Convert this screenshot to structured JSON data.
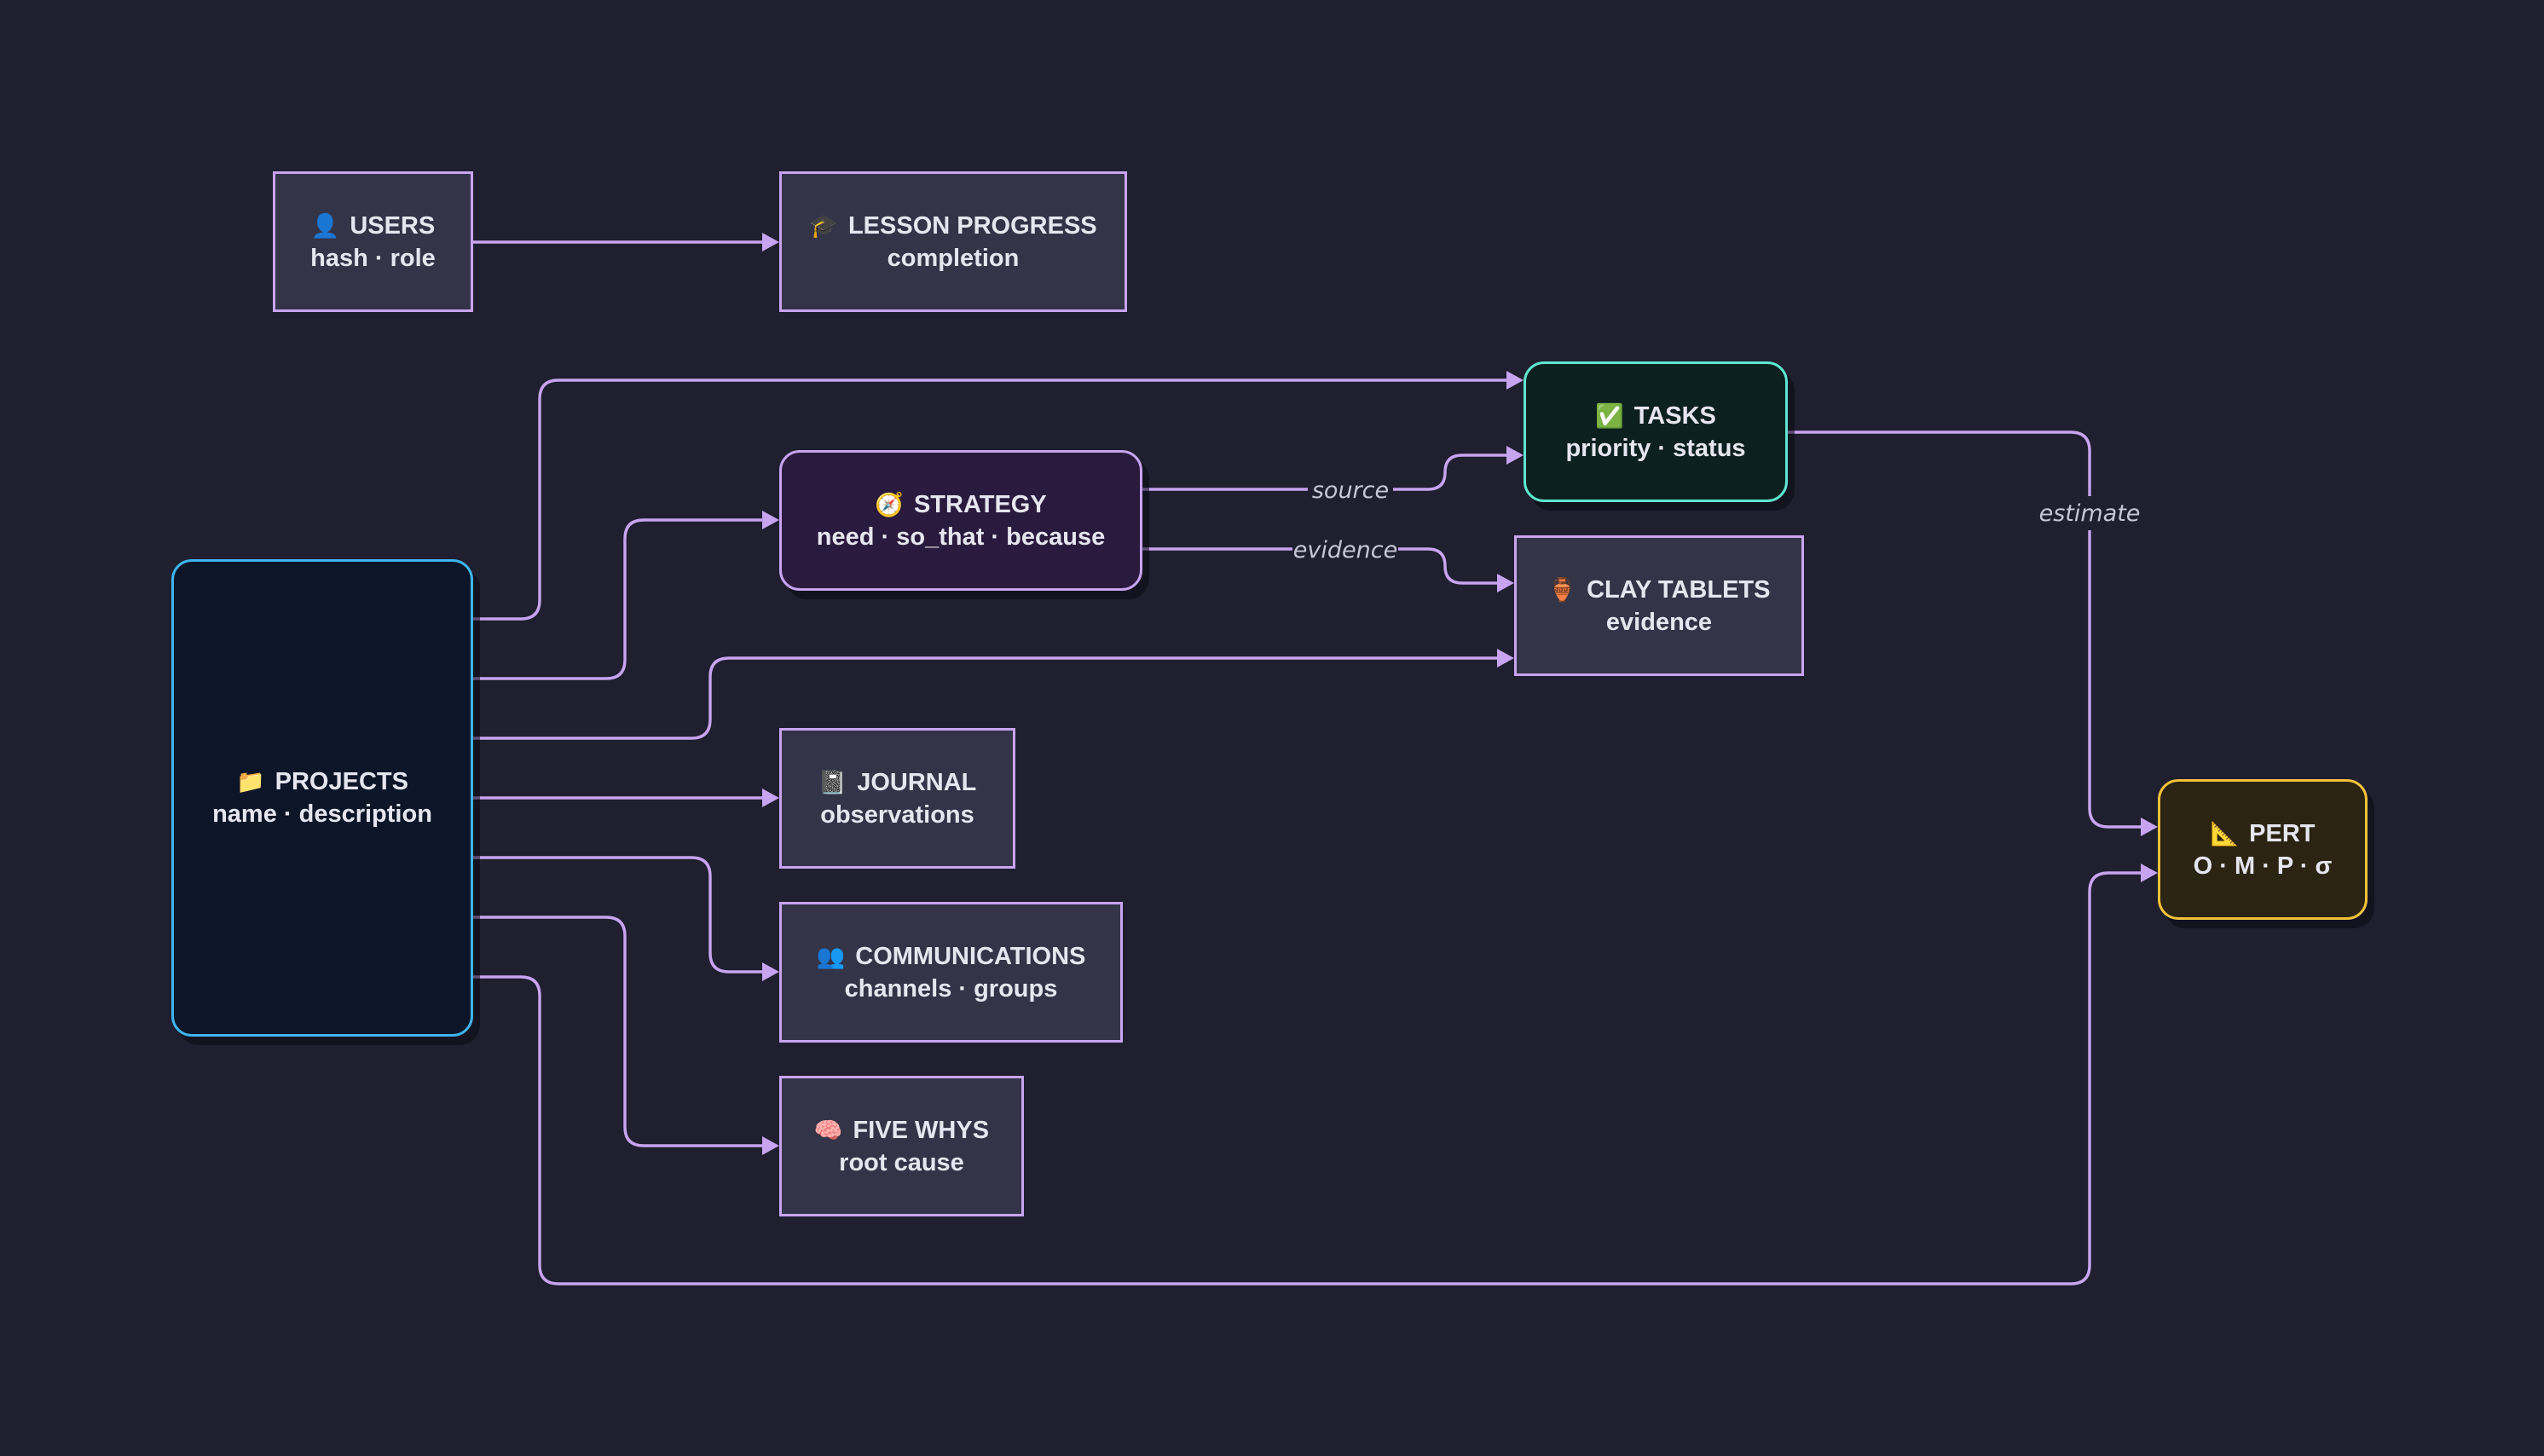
{
  "nodes": {
    "users": {
      "icon": "👤",
      "icon_name": "user-icon",
      "title": "USERS",
      "sub": "hash · role"
    },
    "lesson_progress": {
      "icon": "🎓",
      "icon_name": "graduation-cap-icon",
      "title": "LESSON PROGRESS",
      "sub": "completion"
    },
    "tasks": {
      "icon": "✅",
      "icon_name": "check-box-icon",
      "title": "TASKS",
      "sub": "priority · status"
    },
    "strategy": {
      "icon": "🧭",
      "icon_name": "compass-icon",
      "title": "STRATEGY",
      "sub": "need · so_that · because"
    },
    "clay_tablets": {
      "icon": "🏺",
      "icon_name": "amphora-icon",
      "title": "CLAY TABLETS",
      "sub": "evidence"
    },
    "projects": {
      "icon": "📁",
      "icon_name": "folder-icon",
      "title": "PROJECTS",
      "sub": "name · description"
    },
    "journal": {
      "icon": "📓",
      "icon_name": "notebook-icon",
      "title": "JOURNAL",
      "sub": "observations"
    },
    "communications": {
      "icon": "👥",
      "icon_name": "people-icon",
      "title": "COMMUNICATIONS",
      "sub": "channels · groups"
    },
    "five_whys": {
      "icon": "🧠",
      "icon_name": "brain-icon",
      "title": "FIVE WHYS",
      "sub": "root cause"
    },
    "pert": {
      "icon": "📐",
      "icon_name": "triangle-ruler-icon",
      "title": "PERT",
      "sub": "O · M · P · σ"
    }
  },
  "edges": [
    {
      "from": "users",
      "to": "lesson_progress",
      "label": ""
    },
    {
      "from": "projects",
      "to": "tasks",
      "label": ""
    },
    {
      "from": "projects",
      "to": "strategy",
      "label": ""
    },
    {
      "from": "projects",
      "to": "clay_tablets",
      "label": ""
    },
    {
      "from": "projects",
      "to": "journal",
      "label": ""
    },
    {
      "from": "projects",
      "to": "communications",
      "label": ""
    },
    {
      "from": "projects",
      "to": "five_whys",
      "label": ""
    },
    {
      "from": "projects",
      "to": "pert",
      "label": ""
    },
    {
      "from": "strategy",
      "to": "tasks",
      "label": "source"
    },
    {
      "from": "strategy",
      "to": "clay_tablets",
      "label": "evidence"
    },
    {
      "from": "tasks",
      "to": "pert",
      "label": "estimate"
    }
  ],
  "colors": {
    "background": "#1f1f2f",
    "edge": "#c8a4f0",
    "default_node_border": "#c8a4f0",
    "default_node_fill": "#343448",
    "projects_border": "#3fb4ee",
    "projects_fill": "#0c1628",
    "tasks_border": "#5ee6d0",
    "tasks_fill": "#0d2020",
    "strategy_fill": "#2a1a3e",
    "pert_border": "#f2c23a",
    "pert_fill": "#2b2412"
  }
}
